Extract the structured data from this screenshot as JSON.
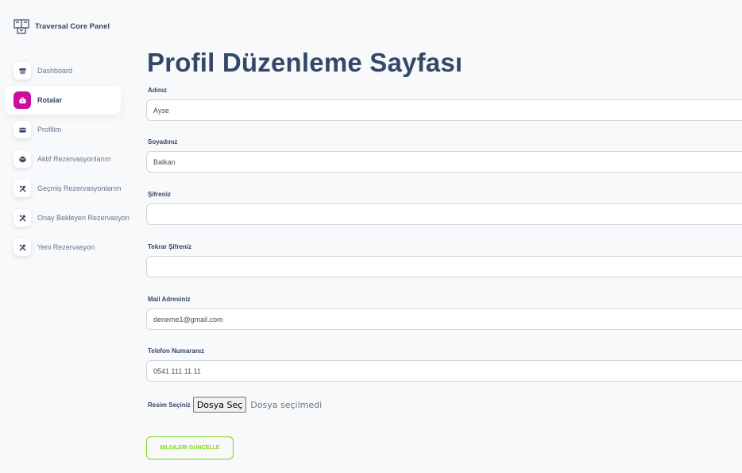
{
  "app": {
    "brand_name": "Traversal Core Panel"
  },
  "sidebar": {
    "items": [
      {
        "label": "Dashboard",
        "icon": "shop-icon",
        "active": false
      },
      {
        "label": "Rotalar",
        "icon": "briefcase-icon",
        "active": true
      },
      {
        "label": "Profilim",
        "icon": "credit-card-icon",
        "active": false
      },
      {
        "label": "Aktif Rezervasyonlarım",
        "icon": "box-icon",
        "active": false
      },
      {
        "label": "Geçmiş Rezervasyonlarım",
        "icon": "tools-icon",
        "active": false
      },
      {
        "label": "Onay Bekleyen Rezervasyon",
        "icon": "tools-icon",
        "active": false
      },
      {
        "label": "Yeni Rezervasyon",
        "icon": "tools-icon",
        "active": false
      }
    ]
  },
  "form": {
    "title": "Profil Düzenleme Sayfası",
    "fields": {
      "name": {
        "label": "Adınız",
        "value": "Ayse"
      },
      "surname": {
        "label": "Soyadınız",
        "value": "Balkan"
      },
      "password": {
        "label": "Şifreniz",
        "value": ""
      },
      "password_repeat": {
        "label": "Tekrar Şifreniz",
        "value": ""
      },
      "email": {
        "label": "Mail Adresiniz",
        "value": "deneme1@gmail.com"
      },
      "phone": {
        "label": "Telefon Numaranız",
        "value": "0541 111 11 11"
      }
    },
    "file": {
      "label": "Resim Seçiniz",
      "button_label": "Dosya Seç",
      "status": "Dosya seçilmedi"
    },
    "submit_label": "BILGILERI GÜNCELLE"
  },
  "colors": {
    "accent": "#cb0c9f",
    "success": "#82d616",
    "heading": "#344767",
    "muted": "#67748e"
  }
}
